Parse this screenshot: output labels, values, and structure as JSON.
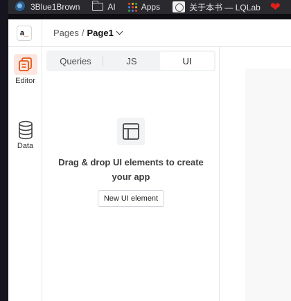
{
  "bookmarks": [
    {
      "label": "3Blue1Brown",
      "icon": "3b1b-logo-icon"
    },
    {
      "label": "AI",
      "icon": "folder-icon"
    },
    {
      "label": "Apps",
      "icon": "apps-grid-icon"
    },
    {
      "label": "关于本书 — LQLab",
      "icon": "lqlab-favicon-icon"
    },
    {
      "label": "",
      "icon": "heart-icon"
    }
  ],
  "app": {
    "logo_text": "a",
    "breadcrumb": {
      "parent": "Pages",
      "separator": "/",
      "current": "Page1"
    },
    "rail": {
      "editor_label": "Editor",
      "data_label": "Data"
    },
    "tabs": [
      {
        "label": "Queries",
        "active": false
      },
      {
        "label": "JS",
        "active": false
      },
      {
        "label": "UI",
        "active": true
      }
    ],
    "empty_state": {
      "message": "Drag & drop UI elements to create your app",
      "button_label": "New UI element"
    }
  },
  "colors": {
    "accent": "#e15615",
    "accent_bg": "#fbe7df",
    "heart": "#e0201b",
    "bookmarks_bg": "#2a2a2e"
  }
}
